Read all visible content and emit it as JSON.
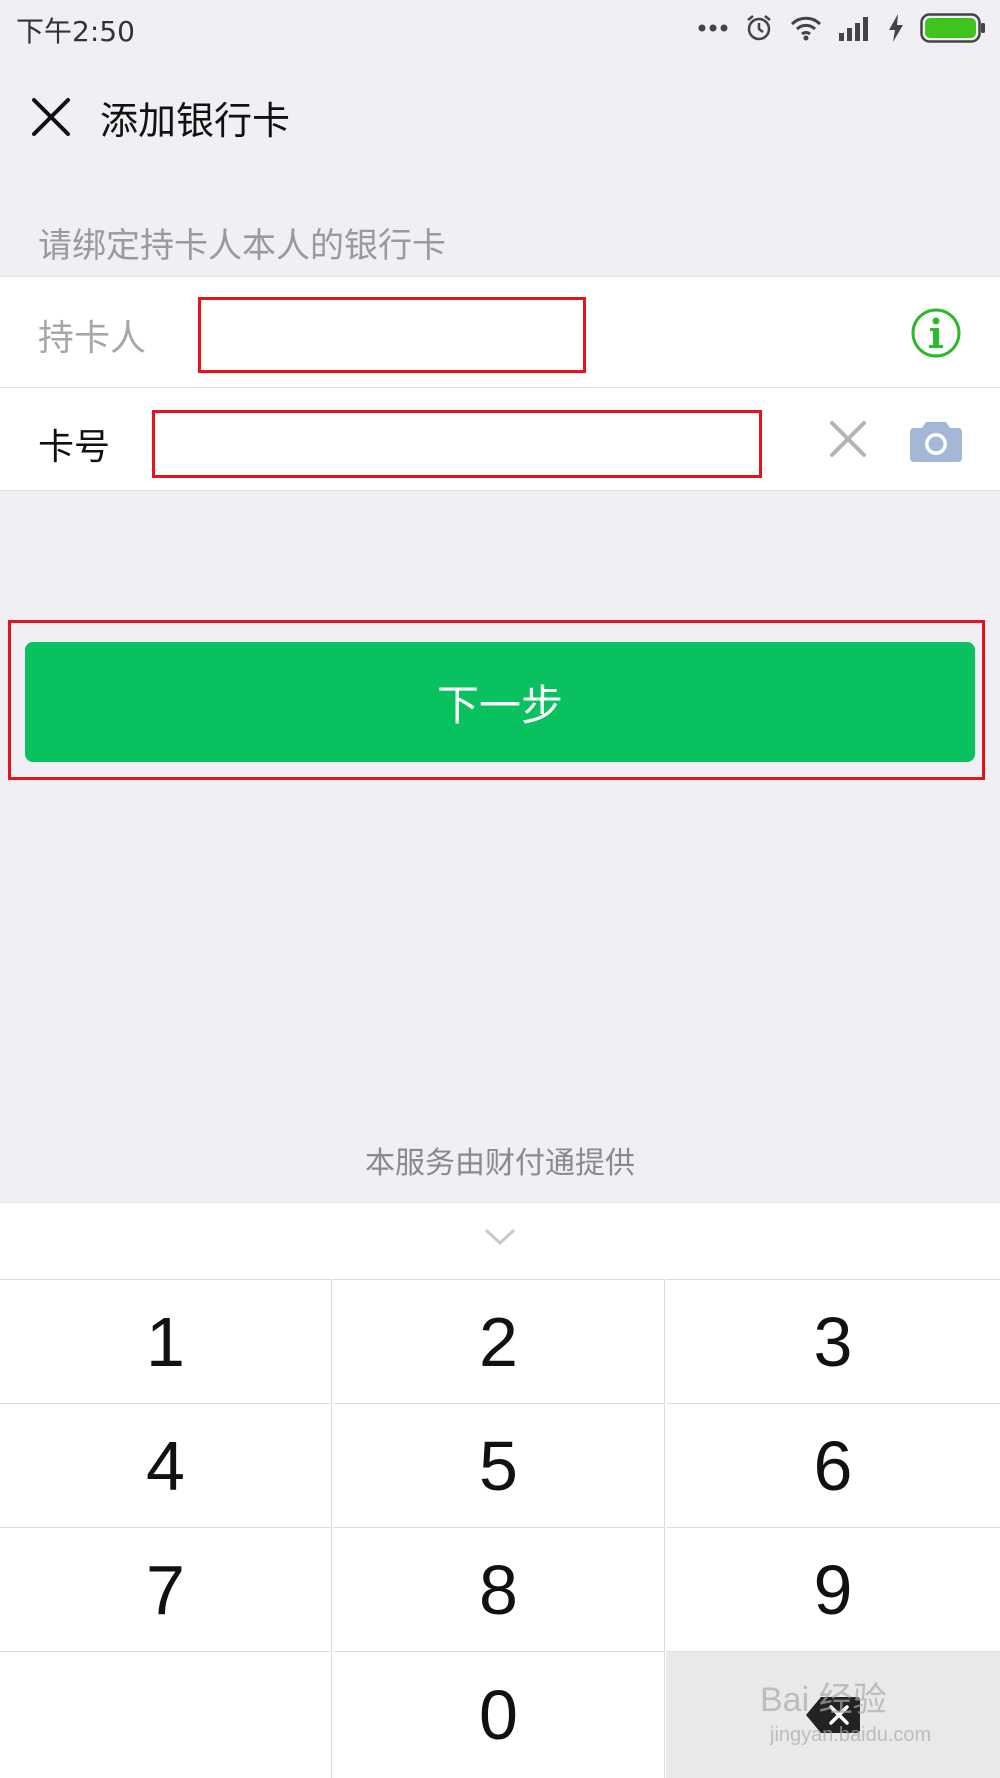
{
  "status_bar": {
    "time": "下午2:50",
    "battery_color": "#3fc41d"
  },
  "header": {
    "title": "添加银行卡",
    "close_icon": "close-icon"
  },
  "form": {
    "hint": "请绑定持卡人本人的银行卡",
    "holder_label": "持卡人",
    "holder_value": "",
    "card_label": "卡号",
    "card_value": "",
    "info_icon": "info-icon",
    "clear_icon": "clear-icon",
    "camera_icon": "camera-icon"
  },
  "next_button": {
    "label": "下一步",
    "color": "#0ac160"
  },
  "provider_text": "本服务由财付通提供",
  "keypad": {
    "keys": [
      "1",
      "2",
      "3",
      "4",
      "5",
      "6",
      "7",
      "8",
      "9",
      "",
      "0",
      ""
    ],
    "backspace_icon": "backspace-icon"
  },
  "annotation_color": "#e5141c",
  "watermark": {
    "main": "Bai 经验",
    "sub": "jingyan.baidu.com"
  }
}
